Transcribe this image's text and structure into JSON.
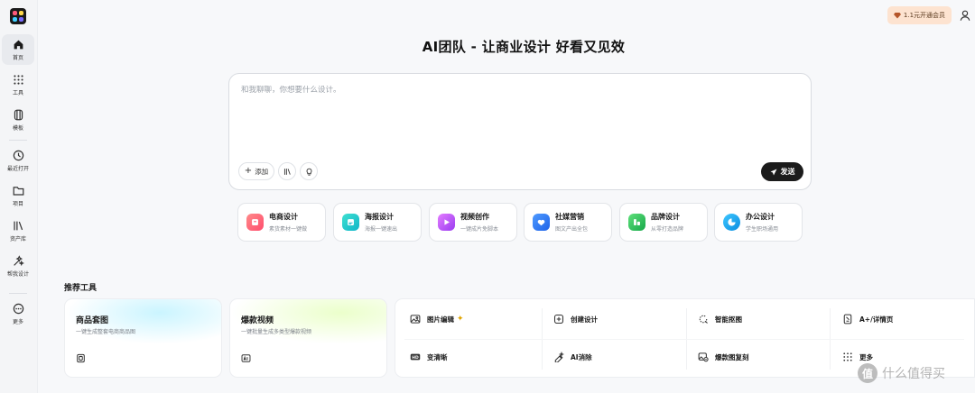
{
  "sidebar": {
    "items": [
      {
        "label": "首页",
        "icon": "home-icon"
      },
      {
        "label": "工具",
        "icon": "grid-icon"
      },
      {
        "label": "模板",
        "icon": "template-icon"
      },
      {
        "label": "最近打开",
        "icon": "clock-icon"
      },
      {
        "label": "项目",
        "icon": "folder-icon"
      },
      {
        "label": "资产库",
        "icon": "library-icon"
      },
      {
        "label": "帮我设计",
        "icon": "wand-icon"
      },
      {
        "label": "更多",
        "icon": "more-icon"
      }
    ]
  },
  "header": {
    "vip_label": "1.1元开通会员",
    "title": "AI团队 - 让商业设计 好看又见效"
  },
  "chat": {
    "placeholder": "和我聊聊，你想要什么设计。",
    "add_label": "添加",
    "send_label": "发送"
  },
  "categories": [
    {
      "title": "电商设计",
      "sub": "素货素材一键做",
      "color": "#ff6b6b"
    },
    {
      "title": "海报设计",
      "sub": "海报一键速出",
      "color": "#22c7c2"
    },
    {
      "title": "视频创作",
      "sub": "一键成片免脚本",
      "color": "#c05cf0"
    },
    {
      "title": "社媒营销",
      "sub": "图文产出全包",
      "color": "#2f7cf6"
    },
    {
      "title": "品牌设计",
      "sub": "从零打造品牌",
      "color": "#34c759"
    },
    {
      "title": "办公设计",
      "sub": "学生职场通用",
      "color": "#1aa3f0"
    }
  ],
  "section": {
    "title": "推荐工具"
  },
  "features": [
    {
      "title": "商品套图",
      "sub": "一键生成整套电商商品图",
      "icon": "product-icon"
    },
    {
      "title": "爆款视频",
      "sub": "一键批量生成多类型爆款视频",
      "icon": "video-ai-icon"
    }
  ],
  "tools": [
    {
      "label": "图片编辑",
      "icon": "image-edit-icon"
    },
    {
      "label": "创建设计",
      "icon": "plus-square-icon"
    },
    {
      "label": "智能抠图",
      "icon": "cutout-icon"
    },
    {
      "label": "A+/详情页",
      "icon": "detail-page-icon"
    },
    {
      "label": "变清晰",
      "icon": "hd-icon"
    },
    {
      "label": "AI消除",
      "icon": "ai-erase-icon"
    },
    {
      "label": "爆款图复刻",
      "icon": "replicate-icon"
    },
    {
      "label": "更多",
      "icon": "more-grid-icon"
    }
  ],
  "watermark": {
    "badge": "值",
    "text": "什么值得买"
  }
}
